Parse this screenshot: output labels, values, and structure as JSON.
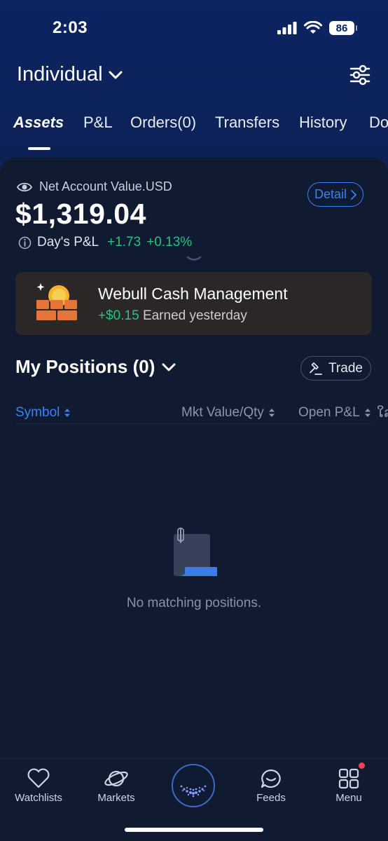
{
  "status_bar": {
    "time": "2:03",
    "battery": "86"
  },
  "header": {
    "account_name": "Individual"
  },
  "tabs": [
    {
      "label": "Assets",
      "active": true
    },
    {
      "label": "P&L"
    },
    {
      "label": "Orders(0)"
    },
    {
      "label": "Transfers"
    },
    {
      "label": "History"
    },
    {
      "label": "Do"
    }
  ],
  "account": {
    "net_value_label": "Net Account Value.USD",
    "net_value": "$1,319.04",
    "detail_label": "Detail",
    "days_pnl_label": "Day's P&L",
    "days_pnl_value": "+1.73",
    "days_pnl_percent": "+0.13%"
  },
  "cash_management": {
    "title": "Webull Cash Management",
    "earned": "+$0.15",
    "earned_label": "Earned yesterday"
  },
  "positions": {
    "title": "My Positions (0)",
    "trade_label": "Trade",
    "columns": [
      "Symbol",
      "Mkt Value/Qty",
      "Open P&L",
      "ໃລ"
    ],
    "empty_text": "No matching positions."
  },
  "bottom_nav": [
    {
      "label": "Watchlists",
      "icon": "heart-icon"
    },
    {
      "label": "Markets",
      "icon": "planet-icon"
    },
    {
      "label": "",
      "icon": "webull-logo-icon"
    },
    {
      "label": "Feeds",
      "icon": "chat-bubble-icon"
    },
    {
      "label": "Menu",
      "icon": "grid-icon"
    }
  ],
  "colors": {
    "header_bg": "#0b2462",
    "panel_bg": "#101a30",
    "accent_blue": "#3b82f6",
    "positive_green": "#26c281",
    "card_bg": "#2c2727",
    "notification_red": "#e8455b"
  }
}
